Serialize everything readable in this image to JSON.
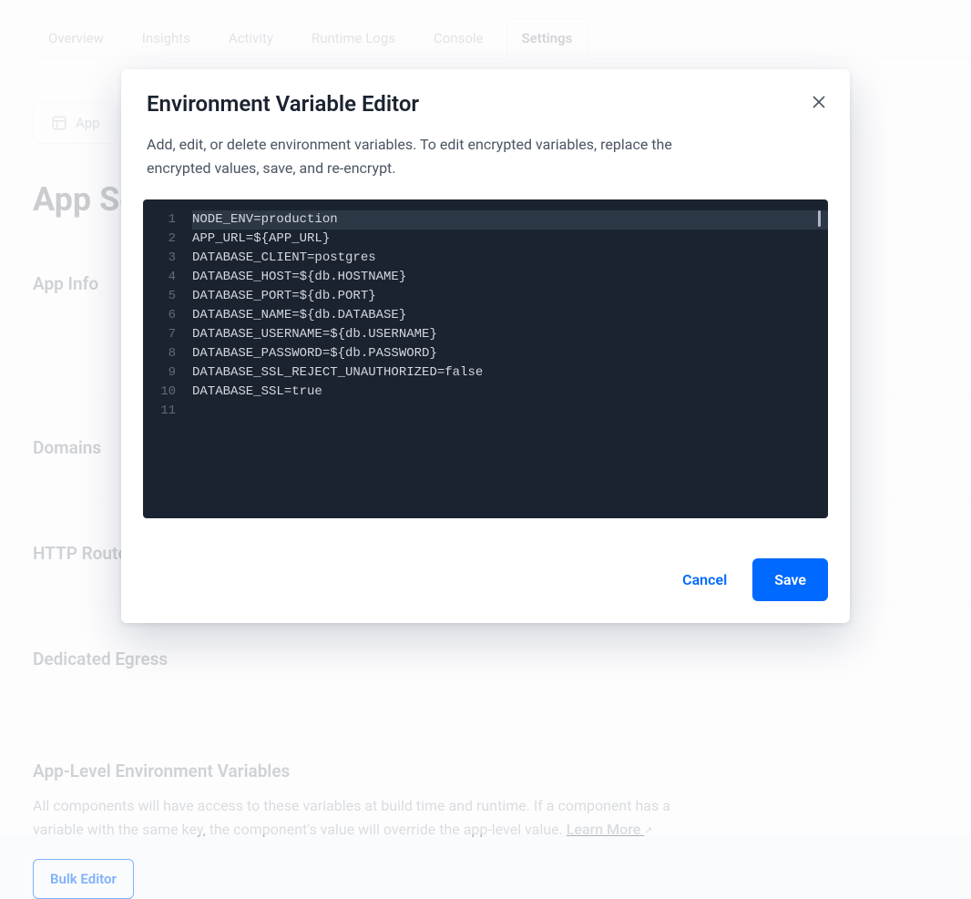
{
  "tabs": {
    "items": [
      {
        "label": "Overview"
      },
      {
        "label": "Insights"
      },
      {
        "label": "Activity"
      },
      {
        "label": "Runtime Logs"
      },
      {
        "label": "Console"
      },
      {
        "label": "Settings"
      }
    ],
    "active_index": 5
  },
  "app_chip": {
    "label": "App",
    "icon": "app-icon"
  },
  "page": {
    "title": "App Settings"
  },
  "sections": {
    "s1": "App Info",
    "s2": "Domains",
    "s3": "HTTP Routes",
    "s4": "Dedicated Egress",
    "env_title": "App-Level Environment Variables",
    "env_desc": "All components will have access to these variables at build time and runtime. If a component has a variable with the same key, the component's value will override the app-level value. ",
    "learn_more": "Learn More",
    "bulk_editor": "Bulk Editor"
  },
  "modal": {
    "title": "Environment Variable Editor",
    "subtitle": "Add, edit, or delete environment variables. To edit encrypted variables, replace the encrypted values, save, and re-encrypt.",
    "buttons": {
      "cancel": "Cancel",
      "save": "Save"
    },
    "editor": {
      "active_line": 1,
      "lines": [
        "NODE_ENV=production",
        "APP_URL=${APP_URL}",
        "DATABASE_CLIENT=postgres",
        "DATABASE_HOST=${db.HOSTNAME}",
        "DATABASE_PORT=${db.PORT}",
        "DATABASE_NAME=${db.DATABASE}",
        "DATABASE_USERNAME=${db.USERNAME}",
        "DATABASE_PASSWORD=${db.PASSWORD}",
        "DATABASE_SSL_REJECT_UNAUTHORIZED=false",
        "DATABASE_SSL=true",
        ""
      ]
    }
  }
}
